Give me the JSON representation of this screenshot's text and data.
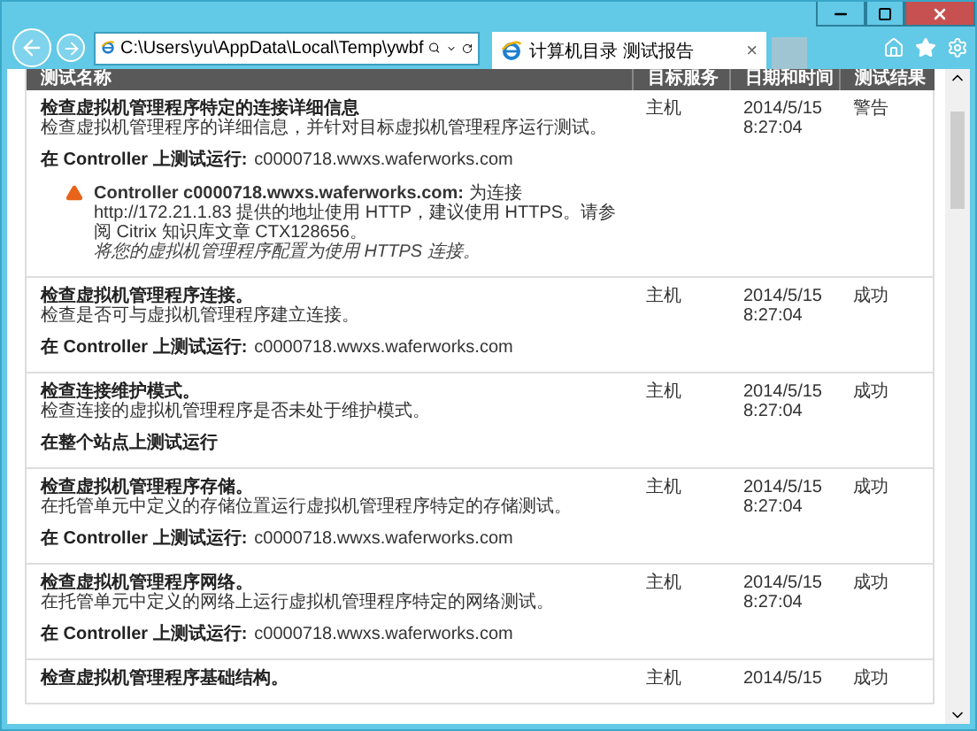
{
  "browser": {
    "address": "C:\\Users\\yu\\AppData\\Local\\Temp\\ywbf",
    "tab_title": "计算机目录 测试报告",
    "tab_close": "×"
  },
  "table": {
    "columns": [
      "测试名称",
      "目标服务",
      "日期和时间",
      "测试结果"
    ],
    "rows": [
      {
        "title": "检查虚拟机管理程序特定的连接详细信息",
        "description": "检查虚拟机管理程序的详细信息，并针对目标虚拟机管理程序运行测试。",
        "run_label": "在 Controller 上测试运行:",
        "run_host": "c0000718.wwxs.waferworks.com",
        "warning": {
          "message": "**Controller c0000718.wwxs.waferworks.com:** 为连接 http://172.21.1.83 提供的地址使用 HTTP，建议使用 HTTPS。请参阅 Citrix 知识库文章 CTX128656。",
          "advice": "将您的虚拟机管理程序配置为使用 HTTPS 连接。"
        },
        "target": "主机",
        "date": "2014/5/15",
        "time": "8:27:04",
        "result": "警告"
      },
      {
        "title": "检查虚拟机管理程序连接。",
        "description": "检查是否可与虚拟机管理程序建立连接。",
        "run_label": "在 Controller 上测试运行:",
        "run_host": "c0000718.wwxs.waferworks.com",
        "target": "主机",
        "date": "2014/5/15",
        "time": "8:27:04",
        "result": "成功"
      },
      {
        "title": "检查连接维护模式。",
        "description": "检查连接的虚拟机管理程序是否未处于维护模式。",
        "run_label": "在整个站点上测试运行",
        "target": "主机",
        "date": "2014/5/15",
        "time": "8:27:04",
        "result": "成功"
      },
      {
        "title": "检查虚拟机管理程序存储。",
        "description": "在托管单元中定义的存储位置运行虚拟机管理程序特定的存储测试。",
        "run_label": "在 Controller 上测试运行:",
        "run_host": "c0000718.wwxs.waferworks.com",
        "target": "主机",
        "date": "2014/5/15",
        "time": "8:27:04",
        "result": "成功"
      },
      {
        "title": "检查虚拟机管理程序网络。",
        "description": "在托管单元中定义的网络上运行虚拟机管理程序特定的网络测试。",
        "run_label": "在 Controller 上测试运行:",
        "run_host": "c0000718.wwxs.waferworks.com",
        "target": "主机",
        "date": "2014/5/15",
        "time": "8:27:04",
        "result": "成功"
      },
      {
        "title": "检查虚拟机管理程序基础结构。",
        "target": "主机",
        "date": "2014/5/15",
        "result": "成功"
      }
    ]
  }
}
